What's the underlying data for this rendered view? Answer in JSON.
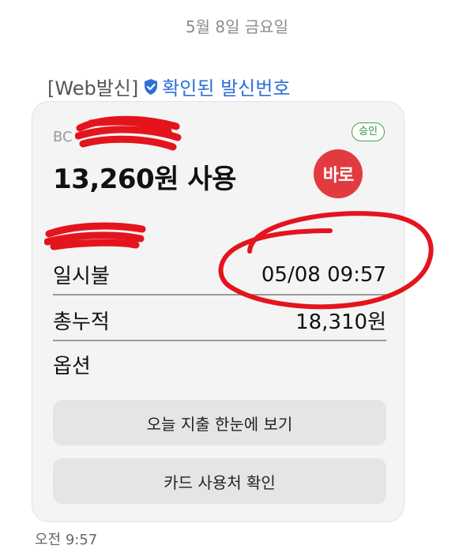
{
  "date_header": "5월 8일 금요일",
  "sender": {
    "prefix": "[Web발신]",
    "verified_label": "확인된 발신번호",
    "verified_color": "#2f6fd9",
    "verified_icon": "shield-check-icon"
  },
  "card": {
    "issuer_partial": "BC",
    "status_badge": "승인",
    "status_color": "#3aa64a",
    "amount_text": "13,260원 사용",
    "logo_text": "바로",
    "logo_color": "#e23b3f",
    "rows": [
      {
        "label": "일시불",
        "value": "05/08 09:57"
      },
      {
        "label": "총누적",
        "value": "18,310원"
      },
      {
        "label": "옵션",
        "value": ""
      }
    ],
    "buttons": [
      {
        "label": "오늘 지출 한눈에 보기"
      },
      {
        "label": "카드 사용처 확인"
      }
    ]
  },
  "message_time": "오전 9:57",
  "annotation_color": "#e4141d"
}
